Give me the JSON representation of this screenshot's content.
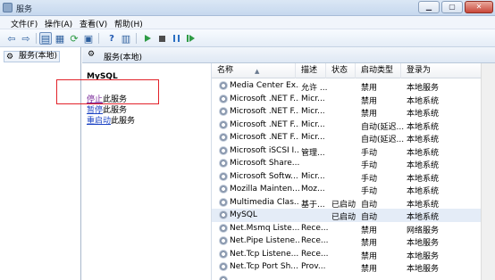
{
  "window": {
    "title": "服务",
    "controls": [
      "minimize",
      "maximize",
      "close"
    ]
  },
  "menu": [
    "文件(F)",
    "操作(A)",
    "查看(V)",
    "帮助(H)"
  ],
  "toolbar_icons": [
    "back-arrow-icon",
    "forward-arrow-icon",
    "show-hide-console-tree-icon",
    "properties-icon",
    "refresh-icon",
    "export-list-icon",
    "help-icon",
    "details-view-icon",
    "start-service-icon",
    "stop-service-icon",
    "pause-service-icon",
    "restart-service-icon"
  ],
  "tree": {
    "root_label": "服务(本地)"
  },
  "panel": {
    "header": "服务(本地)"
  },
  "detail": {
    "service_name": "MySQL",
    "actions": [
      {
        "link": "停止",
        "suffix": "此服务"
      },
      {
        "link": "暂停",
        "suffix": "此服务"
      },
      {
        "link": "重启动",
        "suffix": "此服务"
      }
    ]
  },
  "table": {
    "columns": [
      "名称",
      "描述",
      "状态",
      "启动类型",
      "登录为"
    ],
    "rows": [
      {
        "name": "Media Center Ex...",
        "desc": "允许 ...",
        "status": "",
        "startup": "禁用",
        "logon": "本地服务"
      },
      {
        "name": "Microsoft .NET F...",
        "desc": "Micr...",
        "status": "",
        "startup": "禁用",
        "logon": "本地系统"
      },
      {
        "name": "Microsoft .NET F...",
        "desc": "Micr...",
        "status": "",
        "startup": "禁用",
        "logon": "本地系统"
      },
      {
        "name": "Microsoft .NET F...",
        "desc": "Micr...",
        "status": "",
        "startup": "自动(延迟...",
        "logon": "本地系统"
      },
      {
        "name": "Microsoft .NET F...",
        "desc": "Micr...",
        "status": "",
        "startup": "自动(延迟...",
        "logon": "本地系统"
      },
      {
        "name": "Microsoft iSCSI I...",
        "desc": "管理...",
        "status": "",
        "startup": "手动",
        "logon": "本地系统"
      },
      {
        "name": "Microsoft Share...",
        "desc": "",
        "status": "",
        "startup": "手动",
        "logon": "本地系统"
      },
      {
        "name": "Microsoft Softw...",
        "desc": "Micr...",
        "status": "",
        "startup": "手动",
        "logon": "本地系统"
      },
      {
        "name": "Mozilla Mainten...",
        "desc": "Moz...",
        "status": "",
        "startup": "手动",
        "logon": "本地系统"
      },
      {
        "name": "Multimedia Clas...",
        "desc": "基于...",
        "status": "已启动",
        "startup": "自动",
        "logon": "本地系统"
      },
      {
        "name": "MySQL",
        "desc": "",
        "status": "已启动",
        "startup": "自动",
        "logon": "本地系统"
      },
      {
        "name": "Net.Msmq Liste...",
        "desc": "Rece...",
        "status": "",
        "startup": "禁用",
        "logon": "网络服务"
      },
      {
        "name": "Net.Pipe Listene...",
        "desc": "Rece...",
        "status": "",
        "startup": "禁用",
        "logon": "本地服务"
      },
      {
        "name": "Net.Tcp Listene...",
        "desc": "Rece...",
        "status": "",
        "startup": "禁用",
        "logon": "本地服务"
      },
      {
        "name": "Net.Tcp Port Sh...",
        "desc": "Prov...",
        "status": "",
        "startup": "禁用",
        "logon": "本地服务"
      },
      {
        "name": "",
        "desc": "",
        "status": "",
        "startup": "",
        "logon": ""
      }
    ],
    "selected_row": 10
  }
}
